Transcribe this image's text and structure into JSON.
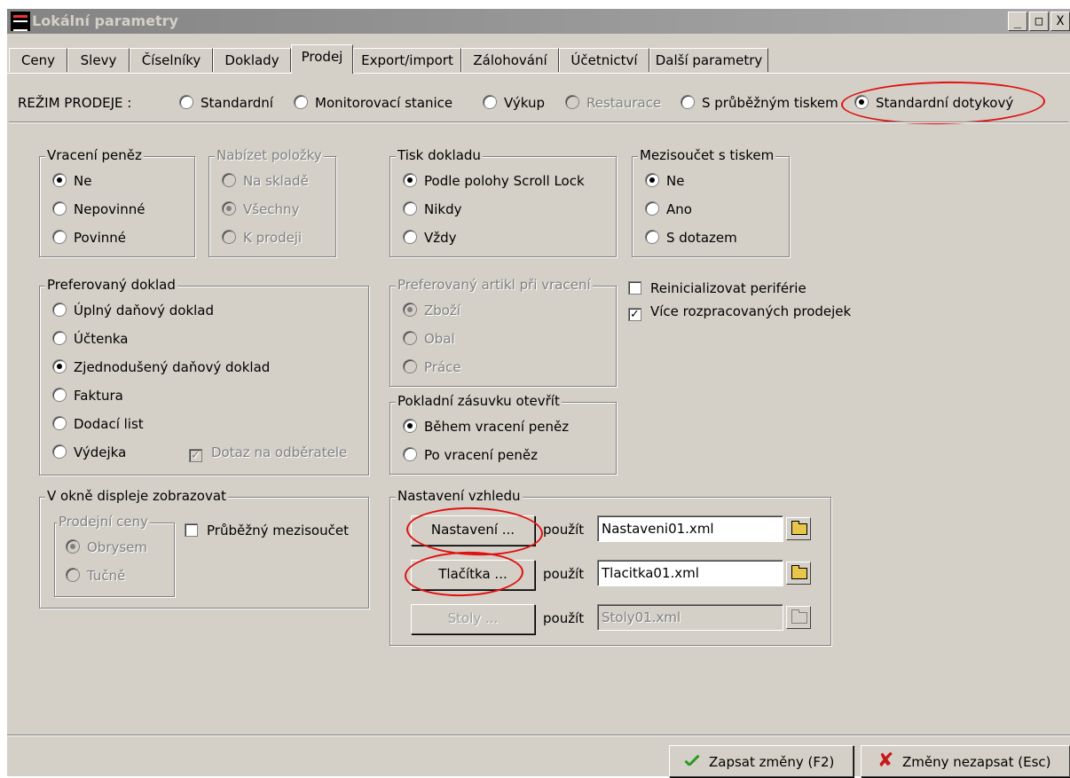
{
  "window": {
    "title": "Lokální parametry",
    "buttons": [
      "_",
      "□",
      "X"
    ]
  },
  "tabs": [
    "Ceny",
    "Slevy",
    "Číselníky",
    "Doklady",
    "Prodej",
    "Export/import",
    "Zálohování",
    "Účetnictví",
    "Další parametry"
  ],
  "active_tab": "Prodej",
  "mode": {
    "label": "REŽIM PRODEJE :",
    "options": [
      "Standardní",
      "Monitorovací stanice",
      "Výkup",
      "Restaurace",
      "S průběžným tiskem",
      "Standardní dotykový"
    ],
    "selected": "Standardní dotykový",
    "disabled": [
      "Restaurace"
    ]
  },
  "vraceni_penez": {
    "title": "Vracení peněz",
    "options": [
      "Ne",
      "Nepovinné",
      "Povinné"
    ],
    "selected": "Ne"
  },
  "nabizet_polozky": {
    "title": "Nabízet položky",
    "options": [
      "Na skladě",
      "Všechny",
      "K prodeji"
    ],
    "selected": "Všechny"
  },
  "tisk_dokladu": {
    "title": "Tisk dokladu",
    "options": [
      "Podle polohy Scroll Lock",
      "Nikdy",
      "Vždy"
    ],
    "selected": "Podle polohy Scroll Lock"
  },
  "mezisoucet": {
    "title": "Mezisoučet s tiskem",
    "options": [
      "Ne",
      "Ano",
      "S dotazem"
    ],
    "selected": "Ne"
  },
  "preferovany_doklad": {
    "title": "Preferovaný doklad",
    "options": [
      "Úplný daňový doklad",
      "Účtenka",
      "Zjednodušený daňový doklad",
      "Faktura",
      "Dodací list",
      "Výdejka"
    ],
    "selected": "Zjednodušený daňový doklad",
    "dotaz_label": "Dotaz na odběratele"
  },
  "preferovany_artikl": {
    "title": "Preferovaný artikl při vracení",
    "options": [
      "Zboží",
      "Obal",
      "Práce"
    ],
    "selected": "Zboží"
  },
  "checkboxes": [
    {
      "label": "Reinicializovat periférie",
      "checked": false
    },
    {
      "label": "Více rozpracovaných prodejek",
      "checked": true
    }
  ],
  "zasuvka": {
    "title": "Pokladní zásuvku otevřít",
    "options": [
      "Během vracení peněz",
      "Po vracení peněz"
    ],
    "selected": "Během vracení peněz"
  },
  "displej": {
    "title": "V okně displeje zobrazovat",
    "ceny_title": "Prodejní ceny",
    "ceny_options": [
      "Obrysem",
      "Tučně"
    ],
    "ceny_selected": "Obrysem",
    "mezisoucet_label": "Průběžný mezisoučet"
  },
  "vzhled": {
    "title": "Nastavení vzhledu",
    "use_label": "použít",
    "rows": [
      {
        "button": "Nastavení ...",
        "file": "Nastaveni01.xml",
        "enabled": true
      },
      {
        "button": "Tlačítka ...",
        "file": "Tlacitka01.xml",
        "enabled": true
      },
      {
        "button": "Stoly ...",
        "file": "Stoly01.xml",
        "enabled": false
      }
    ]
  },
  "footer": {
    "save": "Zapsat změny (F2)",
    "cancel": "Změny nezapsat (Esc)"
  },
  "colors": {
    "face": "#d4d0c8",
    "highlight_ellipse": "#e01010",
    "check_green": "#2a9a20",
    "cancel_red": "#c81818"
  }
}
